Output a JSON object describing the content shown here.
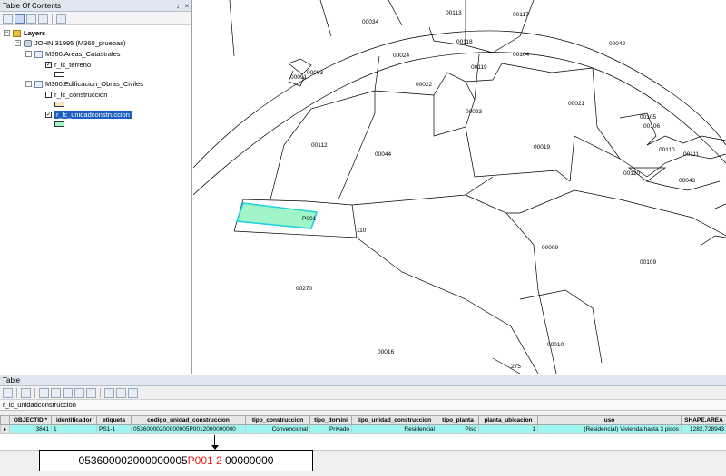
{
  "toc": {
    "title": "Table Of Contents",
    "pin_glyph": "↓",
    "close_glyph": "×",
    "tree": {
      "root": "Layers",
      "database": "JOHN.31995 (M360_pruebas)",
      "group_areas": "M360.Areas_Catastrales",
      "layer_terreno": "r_lc_terreno",
      "group_edificacion": "M360.Edificacion_Obras_Civiles",
      "layer_construccion": "r_lc_construccion",
      "layer_unidad": "r_lc_unidadconstruccion"
    },
    "colors": {
      "unidad_swatch": "#9ff5c8",
      "terreno_swatch": "#ffffff",
      "construccion_swatch": "#f5e6c0",
      "selection": "#1b5fc0"
    }
  },
  "map": {
    "parcels": [
      "00113",
      "00117",
      "00034",
      "00118",
      "00042",
      "00024",
      "00104",
      "00119",
      "00093",
      "00091",
      "00022",
      "00021",
      "00023",
      "00105",
      "00106",
      "00112",
      "00019",
      "00110",
      "00044",
      "00111",
      "00120",
      "00043",
      "P001",
      "110",
      "00009",
      "00109",
      "00270",
      "00010",
      "00016",
      "275"
    ],
    "highlight_color": "#9ff5c8",
    "highlight_stroke": "#20d0e0"
  },
  "table": {
    "title": "Table",
    "layer_tab": "r_lc_unidadconstruccion",
    "columns": [
      "OBJECTID *",
      "identificador",
      "etiqueta",
      "codigo_unidad_construccion",
      "tipo_construccion",
      "tipo_domini",
      "tipo_unidad_construccion",
      "tipo_planta",
      "planta_ubicacion",
      "uso",
      "SHAPE.AREA"
    ],
    "row": {
      "marker": "▸",
      "objectid": "3841",
      "identificador": "1",
      "etiqueta": "PS1-1",
      "codigo": "05360000200000005P0012000000000",
      "tipo_construccion": "Convencional",
      "tipo_domini": "Privado",
      "tipo_unidad": "Residencial",
      "tipo_planta": "Piso",
      "planta_ubicacion": "1",
      "uso": "(Residencial) Vivienda hasta 3 pisos",
      "shape_area": "1282.728943"
    },
    "row_color": "#9ff5f0"
  },
  "annotation": {
    "part1": "053600002000000005",
    "part2": "P001 2",
    "part3": " 00000000",
    "accent": "#e02020"
  }
}
